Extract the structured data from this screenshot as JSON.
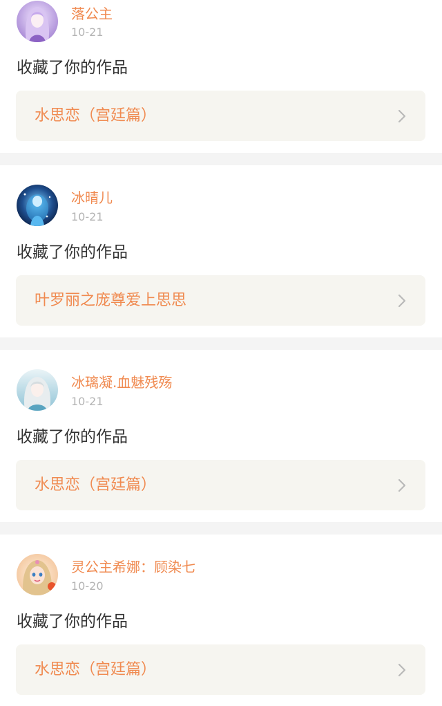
{
  "notifications": [
    {
      "username": "落公主",
      "time": "10-21",
      "action": "收藏了你的作品",
      "work_title": "水思恋（宫廷篇）",
      "avatar_icon": "anime-girl-purple-avatar"
    },
    {
      "username": "冰晴儿",
      "time": "10-21",
      "action": "收藏了你的作品",
      "work_title": "叶罗丽之庞尊爱上思思",
      "avatar_icon": "anime-girl-blue-avatar"
    },
    {
      "username": "冰璃凝.血魅残殇",
      "time": "10-21",
      "action": "收藏了你的作品",
      "work_title": "水思恋（宫廷篇）",
      "avatar_icon": "anime-girl-white-hair-avatar"
    },
    {
      "username": "灵公主希娜：顾染七",
      "time": "10-20",
      "action": "收藏了你的作品",
      "work_title": "水思恋（宫廷篇）",
      "avatar_icon": "doll-princess-avatar"
    }
  ],
  "colors": {
    "accent": "#f08a50",
    "timestamp": "#b4b4b4",
    "text": "#333333",
    "work_card_bg": "#f6f5f0",
    "divider": "#f4f4f4"
  }
}
